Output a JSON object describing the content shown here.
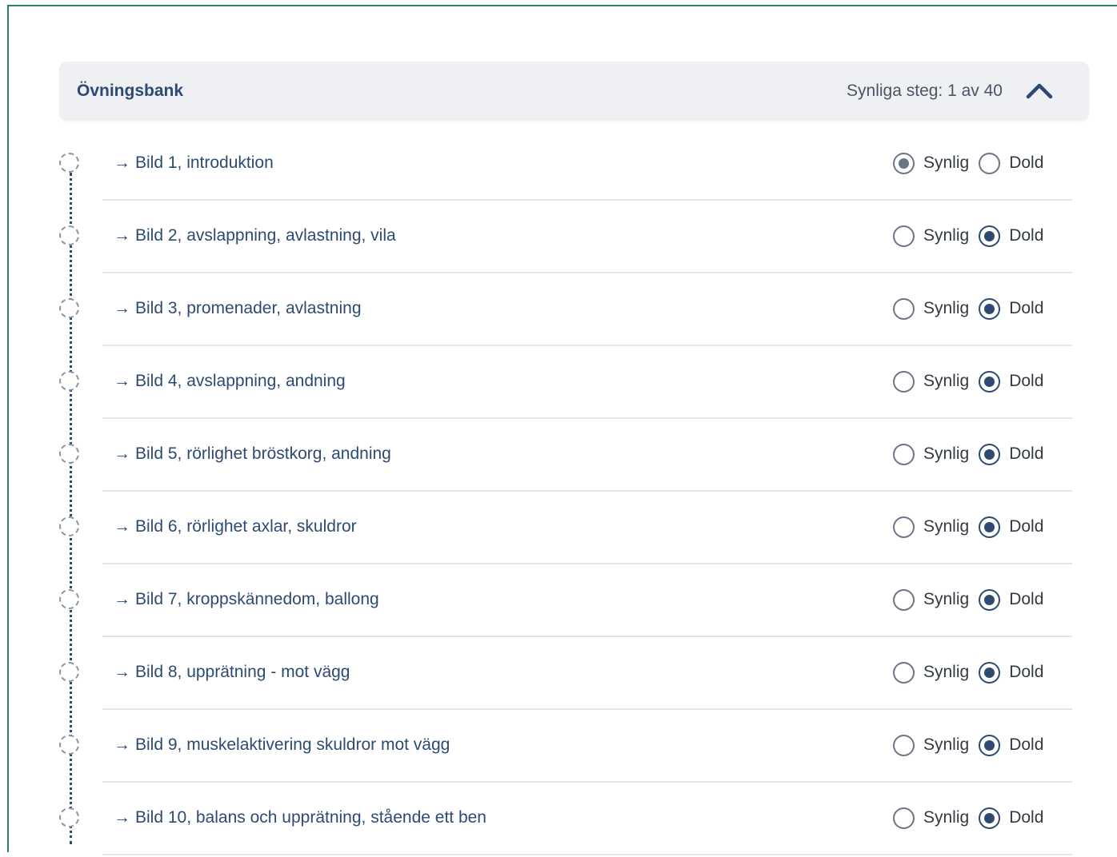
{
  "section": {
    "title": "Övningsbank",
    "visible_steps_text": "Synliga steg: 1 av 40",
    "collapse_icon": "chevron-up-icon",
    "expanded": true
  },
  "radio_labels": {
    "visible": "Synlig",
    "hidden": "Dold"
  },
  "colors": {
    "accent": "#2d4a73",
    "frame_border": "#2f7d6d",
    "header_bg": "#eef0f3"
  },
  "items": [
    {
      "label": "Bild 1, introduktion",
      "visibility": "Synlig"
    },
    {
      "label": "Bild 2, avslappning, avlastning, vila",
      "visibility": "Dold"
    },
    {
      "label": "Bild 3, promenader, avlastning",
      "visibility": "Dold"
    },
    {
      "label": "Bild 4, avslappning, andning",
      "visibility": "Dold"
    },
    {
      "label": "Bild 5, rörlighet bröstkorg, andning",
      "visibility": "Dold"
    },
    {
      "label": "Bild 6, rörlighet axlar, skuldror",
      "visibility": "Dold"
    },
    {
      "label": "Bild 7, kroppskännedom, ballong",
      "visibility": "Dold"
    },
    {
      "label": "Bild 8, upprätning - mot vägg",
      "visibility": "Dold"
    },
    {
      "label": "Bild 9, muskelaktivering skuldror mot vägg",
      "visibility": "Dold"
    },
    {
      "label": "Bild 10, balans och upprätning, stående ett ben",
      "visibility": "Dold"
    }
  ]
}
